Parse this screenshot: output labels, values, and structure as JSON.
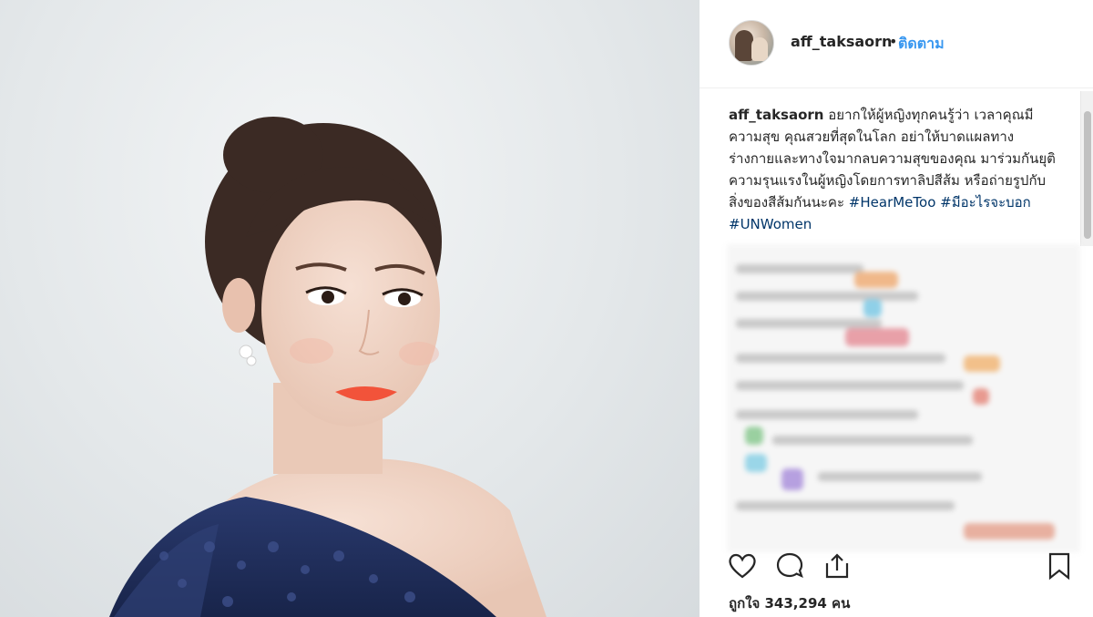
{
  "post": {
    "username": "aff_taksaorn",
    "separator": "•",
    "follow_label": "ติดตาม"
  },
  "caption": {
    "user": "aff_taksaorn",
    "text": "อยากให้ผู้หญิงทุกคนรู้ว่า เวลาคุณมีความสุข คุณสวยที่สุดในโลก อย่าให้บาดแผลทางร่างกายและทางใจมากลบความสุขของคุณ มาร่วมกันยุติความรุนแรงในผู้หญิงโดยการทาลิปสีส้ม หรือถ่ายรูปกับสิ่งของสีส้มกันนะคะ",
    "hashtags": [
      "#HearMeToo",
      "#มีอะไรจะบอก",
      "#UNWomen"
    ]
  },
  "likes": {
    "text": "ถูกใจ 343,294 คน"
  },
  "icons": {
    "like": "heart-icon",
    "comment": "comment-icon",
    "share": "share-icon",
    "save": "bookmark-icon"
  },
  "colors": {
    "link": "#3897f0",
    "hashtag": "#003569",
    "text": "#262626",
    "lipstick": "#f2533a",
    "dress": "#1f2e5c"
  }
}
